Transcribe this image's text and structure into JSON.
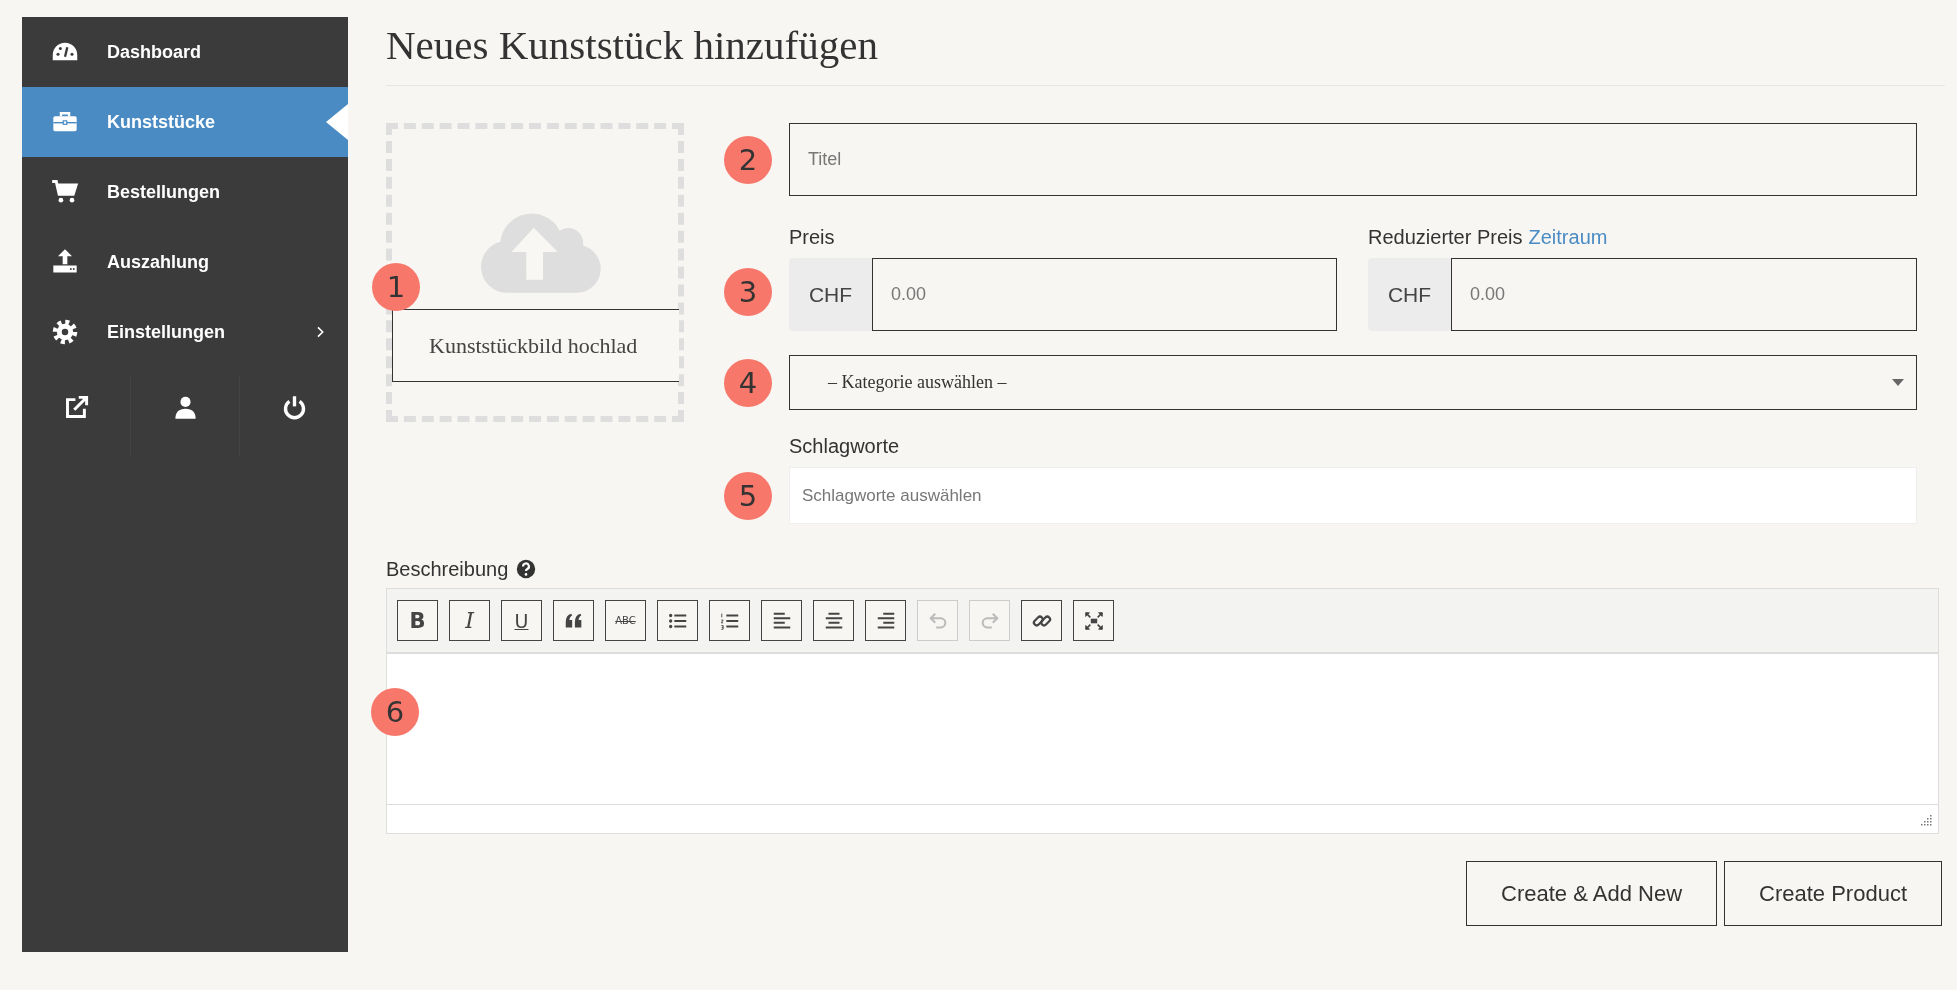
{
  "sidebar": {
    "items": [
      {
        "label": "Dashboard",
        "kind": "gauge",
        "selected": false,
        "submenu": false
      },
      {
        "label": "Kunststücke",
        "kind": "briefcase",
        "selected": true,
        "submenu": false
      },
      {
        "label": "Bestellungen",
        "kind": "cart",
        "selected": false,
        "submenu": false
      },
      {
        "label": "Auszahlung",
        "kind": "upload",
        "selected": false,
        "submenu": false
      },
      {
        "label": "Einstellungen",
        "kind": "gear",
        "selected": false,
        "submenu": true
      }
    ],
    "footer_icons": [
      {
        "kind": "external-link"
      },
      {
        "kind": "user"
      },
      {
        "kind": "power"
      }
    ]
  },
  "page_title": "Neues Kunststück hinzufügen",
  "upload": {
    "marker": "1",
    "button": "Kunststückbild hochlad"
  },
  "form": {
    "title": {
      "marker": "2",
      "placeholder": "Titel"
    },
    "price": {
      "marker": "3",
      "label": "Preis",
      "currency": "CHF",
      "placeholder": "0.00"
    },
    "reduced_price": {
      "label": "Reduzierter Preis",
      "link": "Zeitraum",
      "currency": "CHF",
      "placeholder": "0.00"
    },
    "category": {
      "marker": "4",
      "value": "– Kategorie auswählen –"
    },
    "tags": {
      "marker": "5",
      "label": "Schlagworte",
      "placeholder": "Schlagworte auswählen"
    }
  },
  "description": {
    "label": "Beschreibung",
    "marker": "6",
    "toolbar": [
      {
        "kind": "bold",
        "label": "B",
        "disabled": false
      },
      {
        "kind": "italic",
        "label": "I",
        "disabled": false
      },
      {
        "kind": "underline",
        "label": "U",
        "disabled": false
      },
      {
        "kind": "quote",
        "disabled": false
      },
      {
        "kind": "strikethrough",
        "label": "ABC",
        "disabled": false
      },
      {
        "kind": "bullet-list",
        "disabled": false
      },
      {
        "kind": "numbered-list",
        "disabled": false
      },
      {
        "kind": "align-left",
        "disabled": false
      },
      {
        "kind": "align-center",
        "disabled": false
      },
      {
        "kind": "align-right",
        "disabled": false
      },
      {
        "kind": "undo",
        "disabled": true
      },
      {
        "kind": "redo",
        "disabled": true
      },
      {
        "kind": "link",
        "disabled": false
      },
      {
        "kind": "fullscreen",
        "disabled": false
      }
    ]
  },
  "buttons": [
    {
      "label": "Create & Add New"
    },
    {
      "label": "Create Product"
    }
  ]
}
